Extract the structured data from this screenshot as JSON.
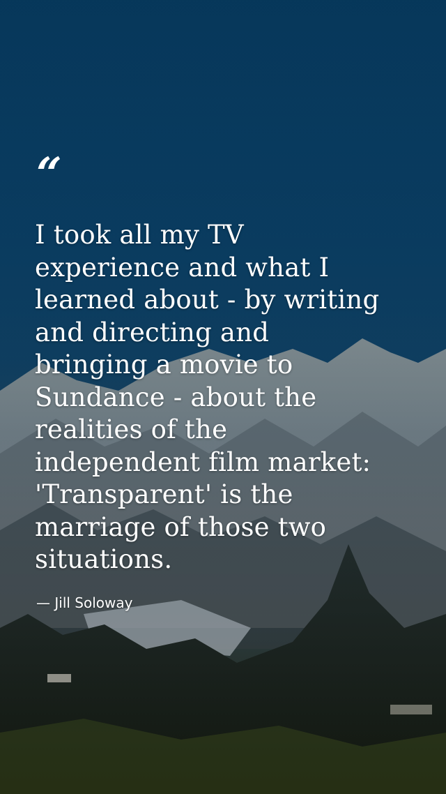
{
  "background": {
    "description_icon": "mountain-landscape-image",
    "sky_color": "#0a3f66"
  },
  "quote": {
    "mark": "“",
    "lines": [
      "I took all my TV",
      "experience and what I",
      "learned about - by writing",
      "and directing and",
      "bringing a movie to",
      "Sundance - about the",
      "realities of the",
      "independent film market:",
      "'Transparent' is the",
      "marriage of those two",
      "situations."
    ],
    "author": "— Jill Soloway"
  }
}
